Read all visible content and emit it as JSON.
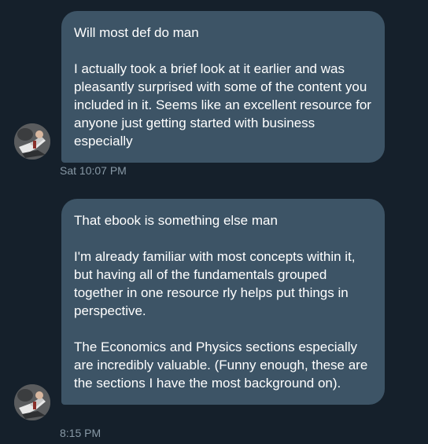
{
  "messages": [
    {
      "paragraphs": [
        "Will most def do man",
        "I actually took a brief look at it earlier and was pleasantly surprised with some of the content you included in it. Seems like an excellent resource for anyone just getting started with business especially"
      ],
      "timestamp": "Sat 10:07 PM"
    },
    {
      "paragraphs": [
        "That ebook is something else man",
        "I'm already familiar with most concepts within it, but having all of the fundamentals grouped together in one resource rly helps put things in perspective.",
        "The Economics and Physics sections especially are incredibly valuable. (Funny enough, these are the sections I have the most background on)."
      ],
      "timestamp": "8:15 PM"
    }
  ],
  "colors": {
    "background": "#15202b",
    "bubble": "#3d5466",
    "text": "#ffffff",
    "timestamp": "#8899a6"
  },
  "icons": {
    "avatar": "user-avatar-photo"
  }
}
